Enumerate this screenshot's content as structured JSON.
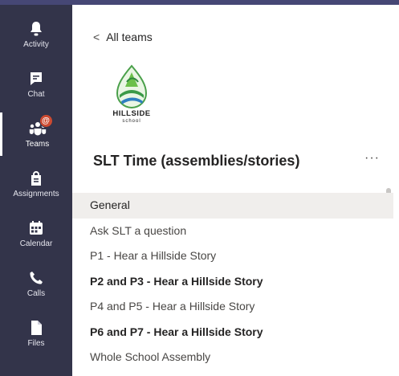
{
  "rail": {
    "items": [
      {
        "label": "Activity",
        "icon": "bell-icon"
      },
      {
        "label": "Chat",
        "icon": "chat-icon"
      },
      {
        "label": "Teams",
        "icon": "teams-icon",
        "badge": "@"
      },
      {
        "label": "Assignments",
        "icon": "assignments-icon"
      },
      {
        "label": "Calendar",
        "icon": "calendar-icon"
      },
      {
        "label": "Calls",
        "icon": "phone-icon"
      },
      {
        "label": "Files",
        "icon": "file-icon"
      }
    ]
  },
  "panel": {
    "back_label": "All teams",
    "logo_text": "HILLSIDE",
    "logo_subtext": "school",
    "team_name": "SLT Time (assemblies/stories)",
    "more_label": "···",
    "channels": [
      {
        "label": "General"
      },
      {
        "label": "Ask SLT a question"
      },
      {
        "label": "P1 - Hear a Hillside Story"
      },
      {
        "label": "P2 and P3 - Hear a Hillside Story"
      },
      {
        "label": "P4 and P5 - Hear a Hillside Story"
      },
      {
        "label": "P6 and P7 - Hear a Hillside Story"
      },
      {
        "label": "Whole School Assembly"
      }
    ]
  },
  "colors": {
    "rail_bg": "#33344a",
    "accent": "#464775",
    "badge": "#cc4a31",
    "selected_bg": "#f0eeec"
  }
}
